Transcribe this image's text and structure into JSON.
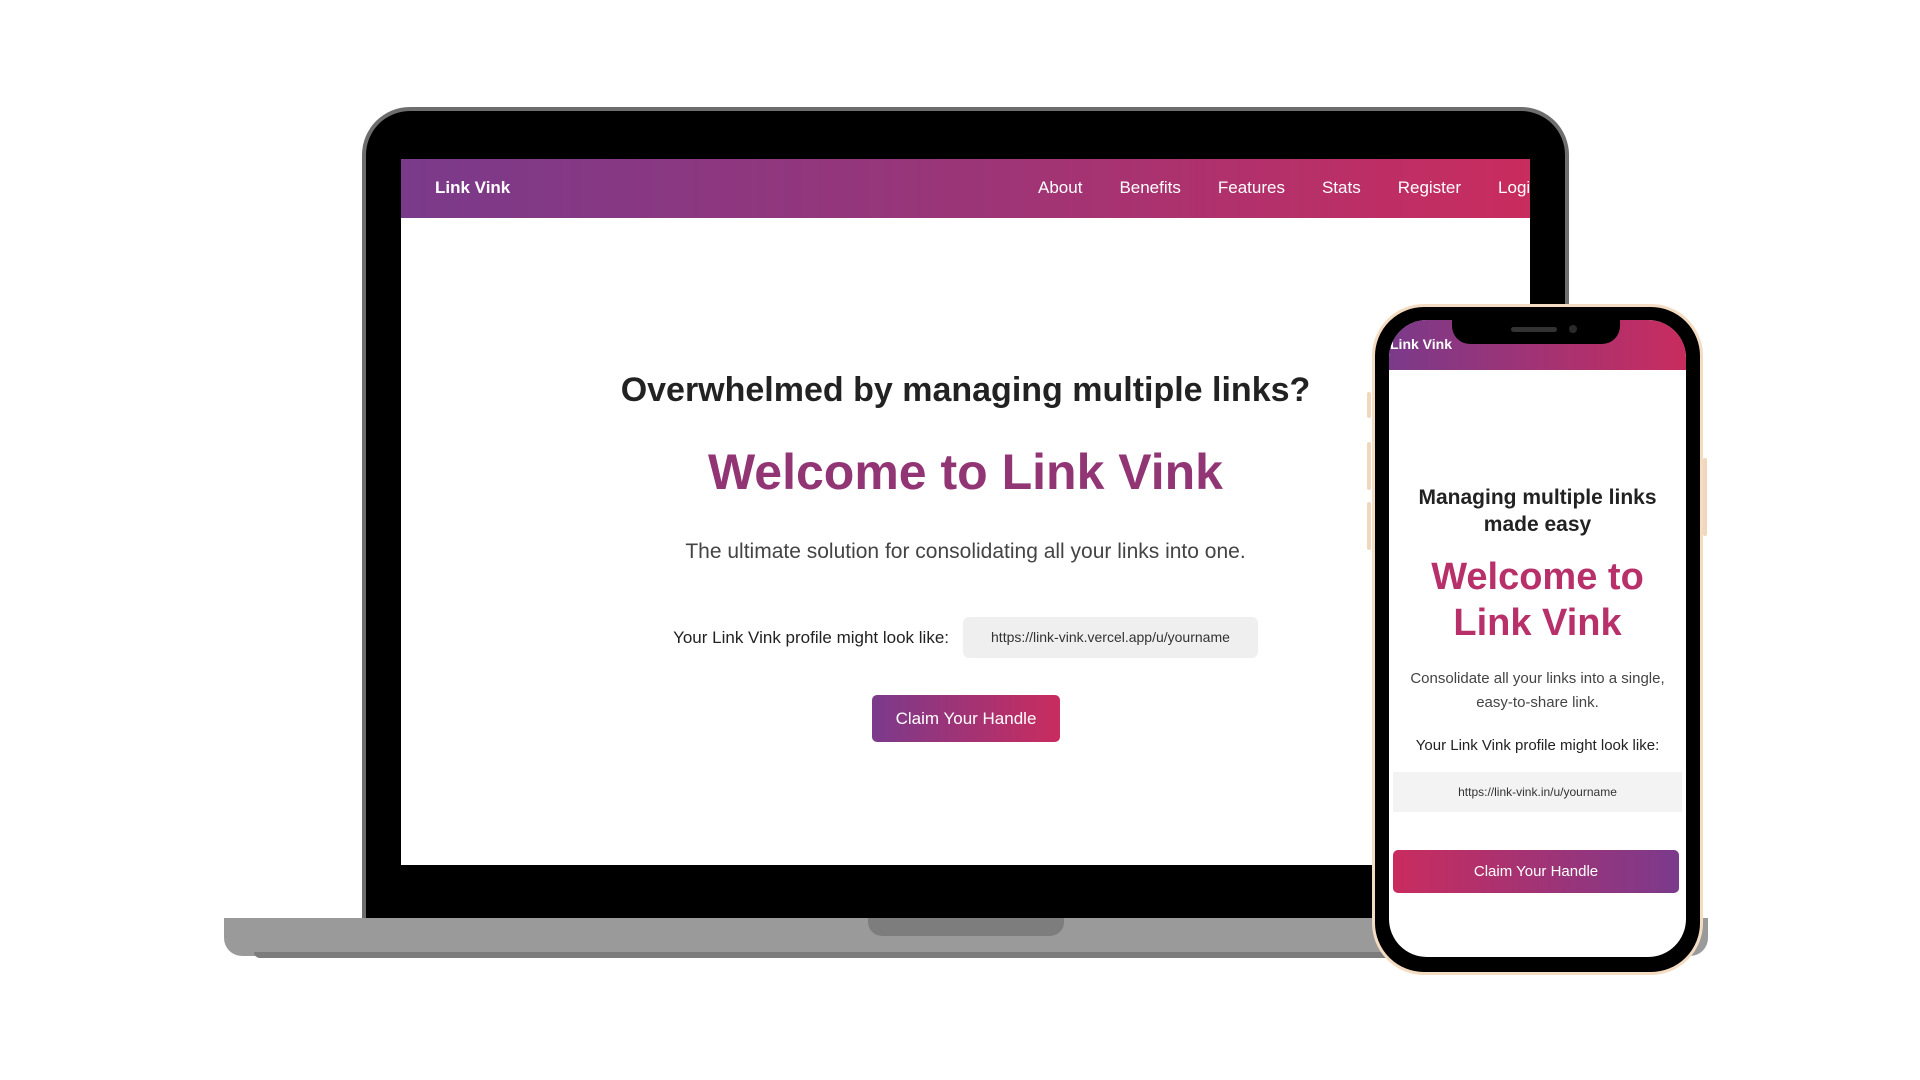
{
  "laptop": {
    "nav": {
      "brand": "Link Vink",
      "links": [
        "About",
        "Benefits",
        "Features",
        "Stats",
        "Register",
        "Logi"
      ]
    },
    "hero": {
      "question": "Overwhelmed by managing multiple links?",
      "title": "Welcome to Link Vink",
      "description": "The ultimate solution for consolidating all your links into one.",
      "profile_label": "Your Link Vink profile might look like:",
      "profile_url": "https://link-vink.vercel.app/u/yourname",
      "cta": "Claim Your Handle"
    }
  },
  "phone": {
    "header": {
      "brand": "Link Vink"
    },
    "hero": {
      "heading": "Managing multiple links made easy",
      "title": "Welcome to Link Vink",
      "description": "Consolidate all your links into a single, easy-to-share link.",
      "profile_label": "Your Link Vink profile might look like:",
      "profile_url": "https://link-vink.in/u/yourname",
      "cta": "Claim Your Handle"
    }
  },
  "colors": {
    "gradient_start": "#7a3a8a",
    "gradient_end": "#c92c5e",
    "title_color": "#913575"
  }
}
